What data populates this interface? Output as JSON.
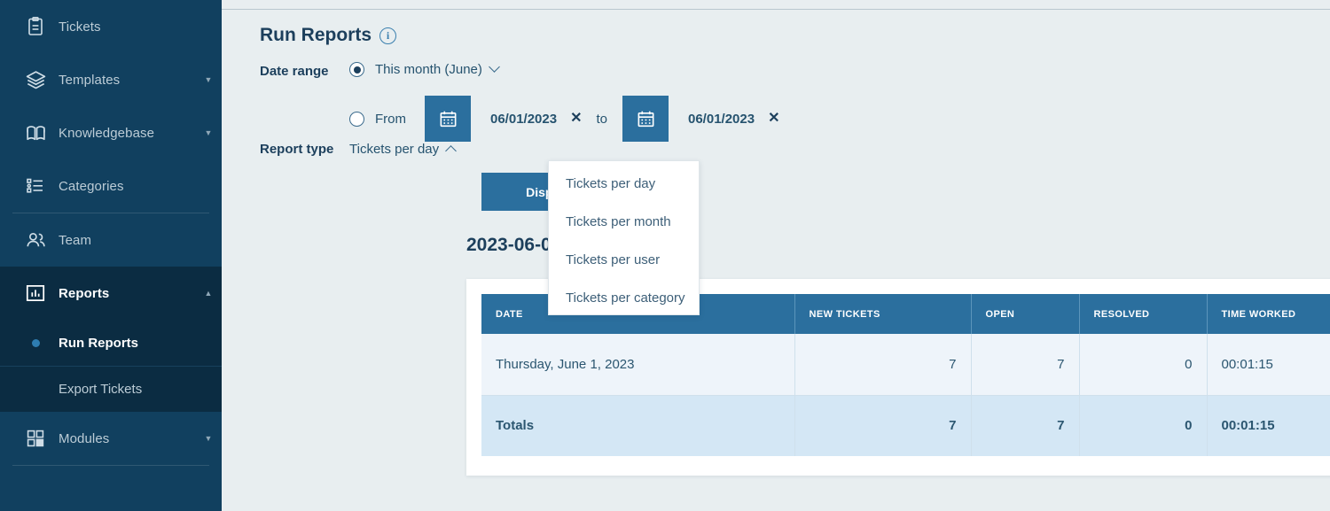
{
  "sidebar": {
    "items": [
      {
        "label": "Tickets",
        "icon": "clipboard-icon",
        "caret": false
      },
      {
        "label": "Templates",
        "icon": "layers-icon",
        "caret": true
      },
      {
        "label": "Knowledgebase",
        "icon": "book-icon",
        "caret": true
      },
      {
        "label": "Categories",
        "icon": "list-icon",
        "caret": false
      },
      {
        "label": "Team",
        "icon": "people-icon",
        "caret": false
      },
      {
        "label": "Reports",
        "icon": "chart-icon",
        "caret": true
      },
      {
        "label": "Modules",
        "icon": "grid-icon",
        "caret": true
      }
    ],
    "sub_items": [
      {
        "label": "Run Reports"
      },
      {
        "label": "Export Tickets"
      }
    ]
  },
  "header": {
    "title": "Run Reports",
    "info_icon": "info-icon",
    "info_glyph": "i"
  },
  "form": {
    "date_range_label": "Date range",
    "preset_option": "This month (June)",
    "from_label": "From",
    "from_date": "06/01/2023",
    "to_label": "to",
    "to_date": "06/01/2023",
    "clear_glyph": "✕",
    "calendar_icon": "calendar-icon",
    "report_type_label": "Report type",
    "report_type_value": "Tickets per day",
    "display_button": "Display"
  },
  "dropdown": {
    "options": [
      "Tickets per day",
      "Tickets per month",
      "Tickets per user",
      "Tickets per category"
    ]
  },
  "results": {
    "heading": "2023-06-0",
    "columns": [
      "DATE",
      "NEW TICKETS",
      "OPEN",
      "RESOLVED",
      "TIME WORKED"
    ],
    "rows": [
      {
        "date": "Thursday, June 1, 2023",
        "new_tickets": "7",
        "open": "7",
        "resolved": "0",
        "time_worked": "00:01:15"
      }
    ],
    "totals": {
      "date": "Totals",
      "new_tickets": "7",
      "open": "7",
      "resolved": "0",
      "time_worked": "00:01:15"
    }
  },
  "colors": {
    "sidebar_bg": "#11405f",
    "sidebar_active": "#0b2c42",
    "accent_blue": "#2b6f9e",
    "content_bg": "#e8eef0",
    "row_bg": "#eef4fa",
    "totals_bg": "#d4e7f5"
  }
}
